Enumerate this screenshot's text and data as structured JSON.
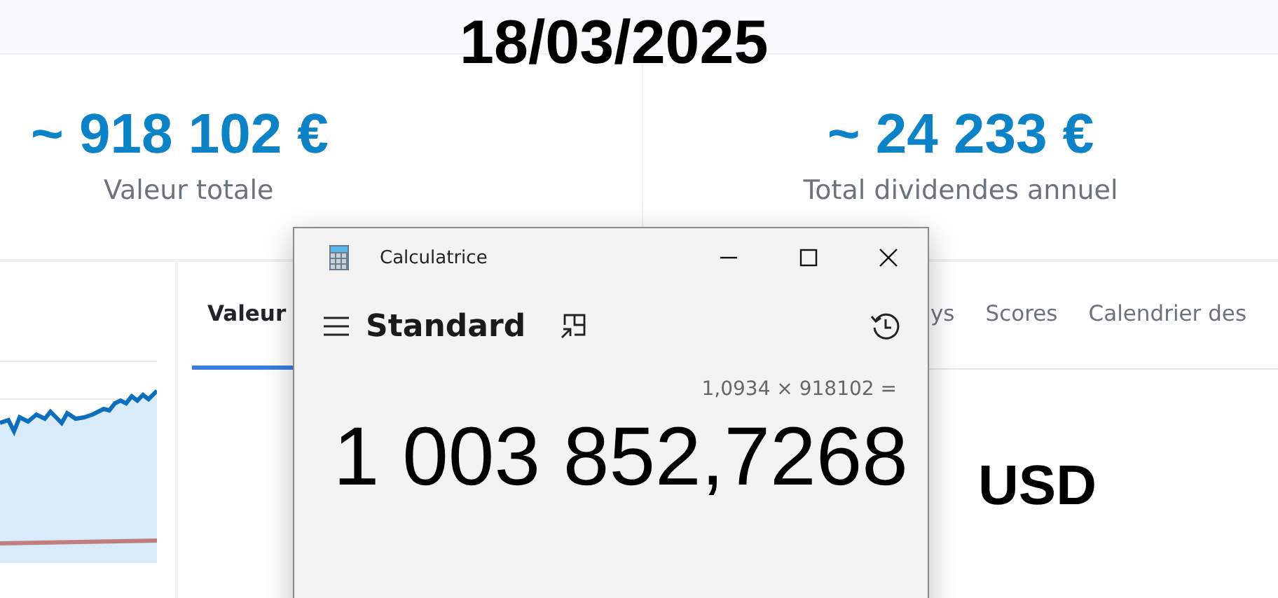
{
  "date_overlay": "18/03/2025",
  "stats": [
    {
      "value": "~ 918 102 €",
      "label": "Valeur totale"
    },
    {
      "value": "~ 24 233 €",
      "label": "Total dividendes annuel"
    }
  ],
  "tabs": [
    {
      "label": "Valeur",
      "selected": true
    },
    {
      "label": "ys",
      "selected": false
    },
    {
      "label": "Scores",
      "selected": false
    },
    {
      "label": "Calendrier des",
      "selected": false
    }
  ],
  "currency_overlay": "USD",
  "calculator": {
    "title": "Calculatrice",
    "mode": "Standard",
    "expression": "1,0934 × 918102 =",
    "result": "1 003 852,7268"
  }
}
